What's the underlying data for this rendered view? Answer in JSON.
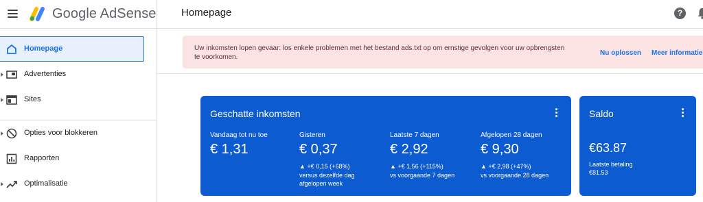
{
  "header": {
    "brand": "Google AdSense",
    "page_title": "Homepage",
    "help_icon": "?"
  },
  "sidebar": {
    "items": [
      {
        "label": "Homepage",
        "icon": "home-icon",
        "active": true
      },
      {
        "label": "Advertenties",
        "icon": "ads-icon",
        "active": false
      },
      {
        "label": "Sites",
        "icon": "sites-icon",
        "active": false
      },
      {
        "label": "Opties voor blokkeren",
        "icon": "block-icon",
        "active": false
      },
      {
        "label": "Rapporten",
        "icon": "reports-icon",
        "active": false
      },
      {
        "label": "Optimalisatie",
        "icon": "trending-up-icon",
        "active": false
      }
    ]
  },
  "banner": {
    "text": "Uw inkomsten lopen gevaar: los enkele problemen met het bestand ads.txt op om ernstige gevolgen voor uw opbrengsten te voorkomen.",
    "fix_link": "Nu oplossen",
    "more_link": "Meer informatie"
  },
  "earnings": {
    "title": "Geschatte inkomsten",
    "kpis": [
      {
        "label": "Vandaag tot nu toe",
        "value": "€ 1,31",
        "change": "",
        "note": ""
      },
      {
        "label": "Gisteren",
        "value": "€ 0,37",
        "change": "▲ +€ 0,15 (+68%)",
        "note": "versus dezelfde dag afgelopen week"
      },
      {
        "label": "Laatste 7 dagen",
        "value": "€ 2,92",
        "change": "▲ +€ 1,56 (+115%)",
        "note": "vs voorgaande 7 dagen"
      },
      {
        "label": "Afgelopen 28 dagen",
        "value": "€ 9,30",
        "change": "▲ +€ 2,98 (+47%)",
        "note": "vs voorgaande 28 dagen"
      }
    ]
  },
  "balance": {
    "title": "Saldo",
    "value": "€63.87",
    "last_payment_label": "Laatste betaling",
    "last_payment_value": "€81.53"
  },
  "colors": {
    "accent": "#1a73e8",
    "card": "#0d5bd1",
    "banner": "#fbe3e3"
  }
}
